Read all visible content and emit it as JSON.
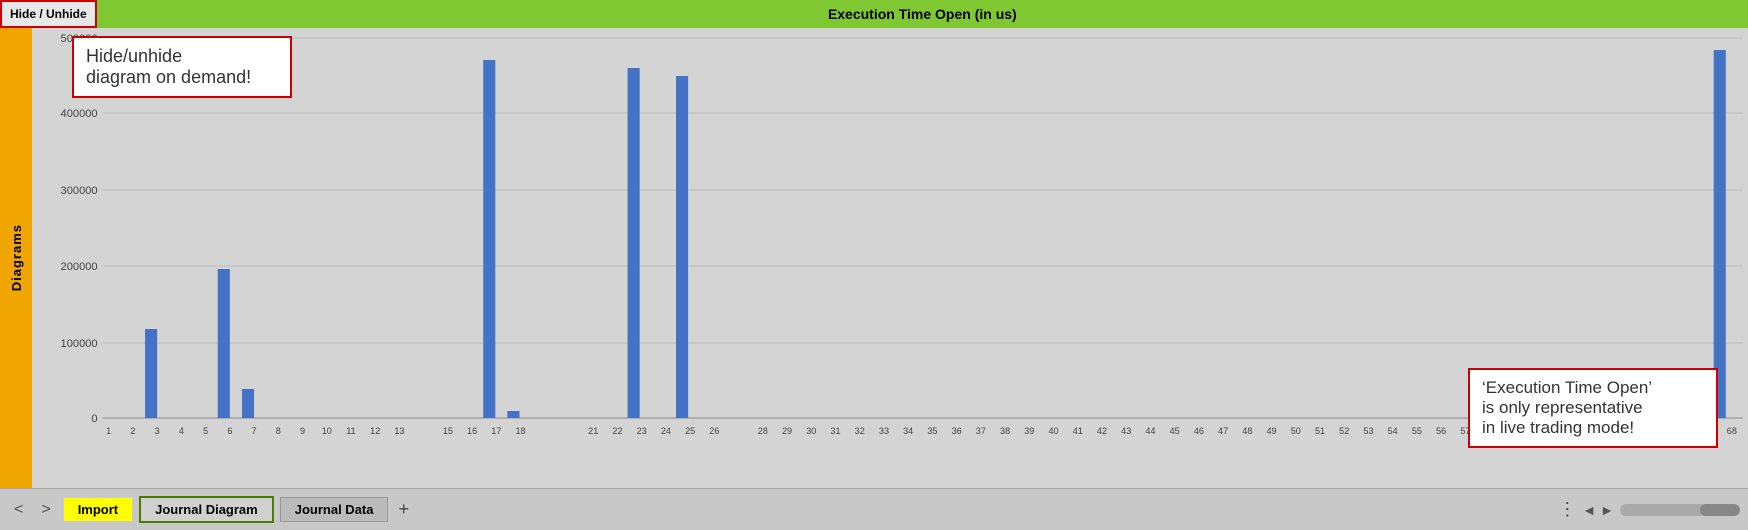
{
  "topBar": {
    "hideUnhideLabel": "Hide / Unhide",
    "title": "Execution Time Open (in us)"
  },
  "sidebar": {
    "label": "Diagrams"
  },
  "chart": {
    "yAxisLabel": "",
    "yTicks": [
      "500000",
      "400000",
      "300000",
      "200000",
      "100000",
      "0"
    ],
    "bars": [
      {
        "x": 2,
        "value": 0
      },
      {
        "x": 3,
        "value": 120000
      },
      {
        "x": 6,
        "value": 200000
      },
      {
        "x": 7,
        "value": 40000
      },
      {
        "x": 17,
        "value": 480000
      },
      {
        "x": 18,
        "value": 10000
      },
      {
        "x": 23,
        "value": 470000
      },
      {
        "x": 25,
        "value": 460000
      },
      {
        "x": 68,
        "value": 495000
      }
    ],
    "maxValue": 510000,
    "annotationTopLeft": "Hide/unhide\ndiagram on demand!",
    "annotationBottomRight": "'Execution Time Open'\nis only representative\nin live trading mode!"
  },
  "bottomBar": {
    "prevLabel": "<",
    "nextLabel": ">",
    "importLabel": "Import",
    "tabs": [
      {
        "label": "Journal Diagram",
        "active": true
      },
      {
        "label": "Journal Data",
        "active": false
      }
    ],
    "addLabel": "+",
    "moreLabel": "⋮",
    "scrollArrowLeft": "◄",
    "scrollArrowRight": "►"
  }
}
